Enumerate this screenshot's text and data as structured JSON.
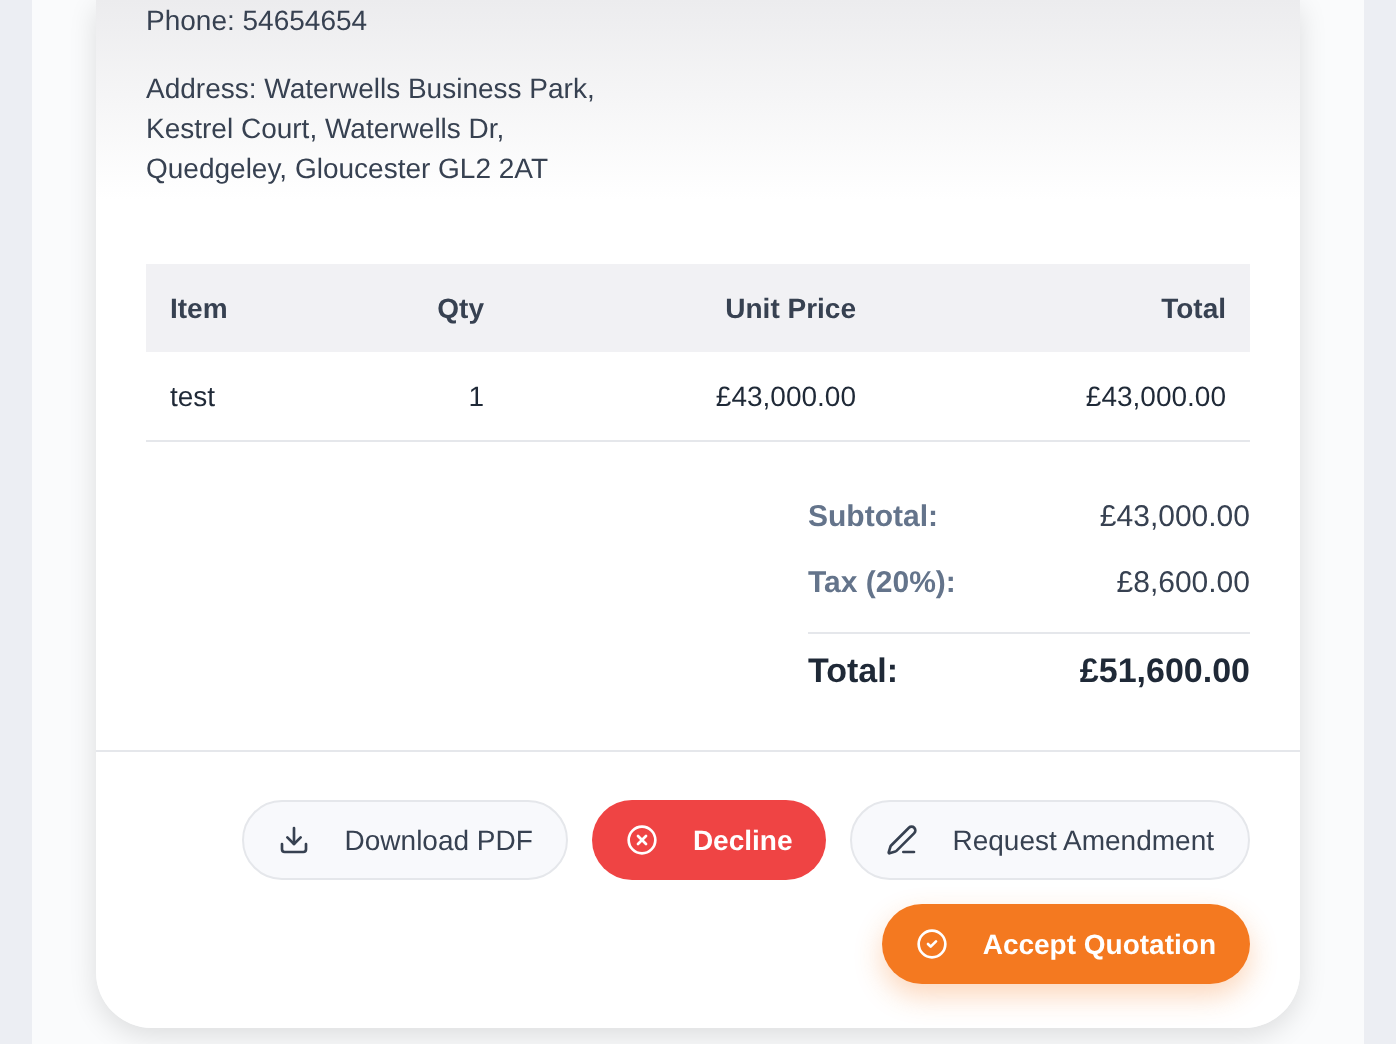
{
  "contact": {
    "phone": "Phone: 54654654",
    "address": [
      "Address: Waterwells Business Park,",
      "Kestrel Court, Waterwells Dr,",
      "Quedgeley, Gloucester GL2 2AT"
    ]
  },
  "table": {
    "columns": [
      "Item",
      "Qty",
      "Unit Price",
      "Total"
    ],
    "rows": [
      [
        "test",
        "1",
        "£43,000.00",
        "£43,000.00"
      ]
    ]
  },
  "summary": [
    {
      "label": "Subtotal:",
      "value": "£43,000.00",
      "kind": "line"
    },
    {
      "label": "Tax (20%):",
      "value": "£8,600.00",
      "kind": "line"
    },
    {
      "label": "Total:",
      "value": "£51,600.00",
      "kind": "total"
    }
  ],
  "actions": [
    {
      "label": "Download PDF",
      "kind": "secondary"
    },
    {
      "label": "Decline",
      "kind": "danger"
    },
    {
      "label": "Request Amendment",
      "kind": "secondary"
    },
    {
      "label": "Accept Quotation",
      "kind": "primary"
    }
  ]
}
